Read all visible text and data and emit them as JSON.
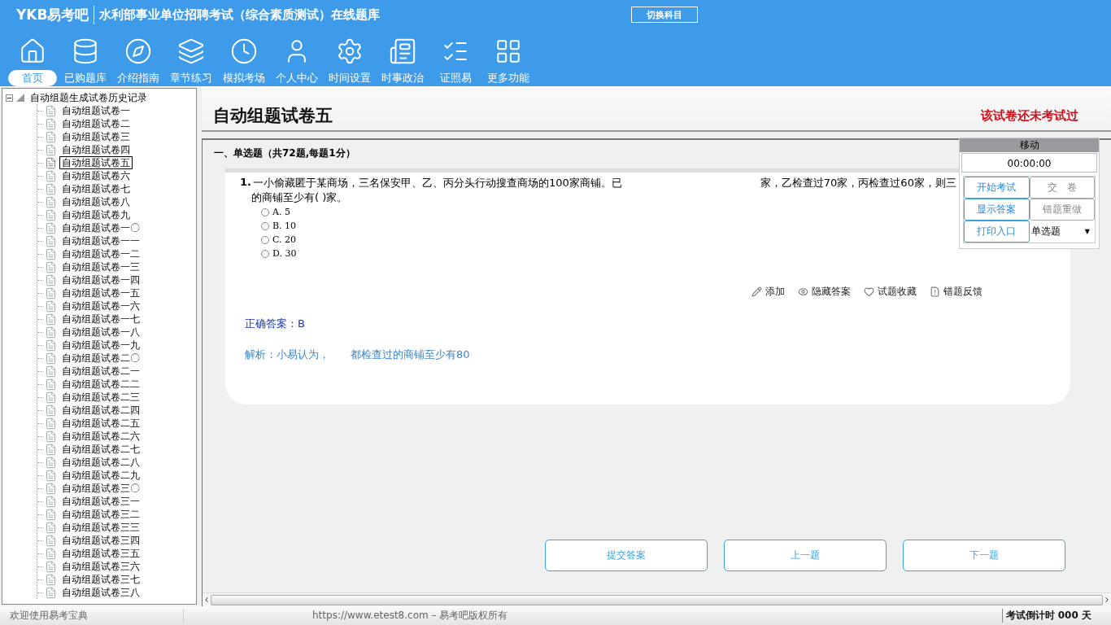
{
  "header": {
    "logo": "YKB易考吧",
    "title": "水利部事业单位招聘考试（综合素质测试）在线题库",
    "switch_button": "切换科目"
  },
  "toolbar": [
    {
      "label": "首页",
      "selected": true
    },
    {
      "label": "已购题库",
      "selected": false
    },
    {
      "label": "介绍指南",
      "selected": false
    },
    {
      "label": "章节练习",
      "selected": false
    },
    {
      "label": "模拟考场",
      "selected": false
    },
    {
      "label": "个人中心",
      "selected": false
    },
    {
      "label": "时间设置",
      "selected": false
    },
    {
      "label": "时事政治",
      "selected": false
    },
    {
      "label": "证照易",
      "selected": false
    },
    {
      "label": "更多功能",
      "selected": false
    }
  ],
  "tree": {
    "root": "自动组题生成试卷历史记录",
    "expanded": true,
    "children": [
      {
        "label": "自动组题试卷一",
        "selected": false
      },
      {
        "label": "自动组题试卷二",
        "selected": false
      },
      {
        "label": "自动组题试卷三",
        "selected": false
      },
      {
        "label": "自动组题试卷四",
        "selected": false
      },
      {
        "label": "自动组题试卷五",
        "selected": true
      },
      {
        "label": "自动组题试卷六",
        "selected": false
      },
      {
        "label": "自动组题试卷七",
        "selected": false
      },
      {
        "label": "自动组题试卷八",
        "selected": false
      },
      {
        "label": "自动组题试卷九",
        "selected": false
      },
      {
        "label": "自动组题试卷一〇",
        "selected": false
      },
      {
        "label": "自动组题试卷一一",
        "selected": false
      },
      {
        "label": "自动组题试卷一二",
        "selected": false
      },
      {
        "label": "自动组题试卷一三",
        "selected": false
      },
      {
        "label": "自动组题试卷一四",
        "selected": false
      },
      {
        "label": "自动组题试卷一五",
        "selected": false
      },
      {
        "label": "自动组题试卷一六",
        "selected": false
      },
      {
        "label": "自动组题试卷一七",
        "selected": false
      },
      {
        "label": "自动组题试卷一八",
        "selected": false
      },
      {
        "label": "自动组题试卷一九",
        "selected": false
      },
      {
        "label": "自动组题试卷二〇",
        "selected": false
      },
      {
        "label": "自动组题试卷二一",
        "selected": false
      },
      {
        "label": "自动组题试卷二二",
        "selected": false
      },
      {
        "label": "自动组题试卷二三",
        "selected": false
      },
      {
        "label": "自动组题试卷二四",
        "selected": false
      },
      {
        "label": "自动组题试卷二五",
        "selected": false
      },
      {
        "label": "自动组题试卷二六",
        "selected": false
      },
      {
        "label": "自动组题试卷二七",
        "selected": false
      },
      {
        "label": "自动组题试卷二八",
        "selected": false
      },
      {
        "label": "自动组题试卷二九",
        "selected": false
      },
      {
        "label": "自动组题试卷三〇",
        "selected": false
      },
      {
        "label": "自动组题试卷三一",
        "selected": false
      },
      {
        "label": "自动组题试卷三二",
        "selected": false
      },
      {
        "label": "自动组题试卷三三",
        "selected": false
      },
      {
        "label": "自动组题试卷三四",
        "selected": false
      },
      {
        "label": "自动组题试卷三五",
        "selected": false
      },
      {
        "label": "自动组题试卷三六",
        "selected": false
      },
      {
        "label": "自动组题试卷三七",
        "selected": false
      },
      {
        "label": "自动组题试卷三八",
        "selected": false
      }
    ]
  },
  "paper": {
    "title": "自动组题试卷五",
    "status": "该试卷还未考试过",
    "section": "一、单选题（共72题,每题1分）"
  },
  "question": {
    "number": "1.",
    "text_before": "一小偷藏匿于某商场，三名保安甲、乙、丙分头行动搜查商场的100家商铺。已",
    "text_after": "家，乙检查过70家，丙检查过60家，则三",
    "text_line2": "的商铺至少有( )家。",
    "options": [
      {
        "label": "A. 5",
        "selected": false
      },
      {
        "label": "B. 10",
        "selected": false
      },
      {
        "label": "C. 20",
        "selected": false
      },
      {
        "label": "D. 30",
        "selected": false
      }
    ],
    "tools": [
      "添加",
      "隐藏答案",
      "试题收藏",
      "错题反馈"
    ],
    "answer": "正确答案：B",
    "analysis_before": "解析：小易认为，",
    "analysis_after": "都检查过的商铺至少有80"
  },
  "float_panel": {
    "title": "移动",
    "timer": "00:00:00",
    "buttons": [
      {
        "label": "开始考试",
        "disabled": false
      },
      {
        "label": "交　卷",
        "disabled": true
      },
      {
        "label": "显示答案",
        "disabled": false
      },
      {
        "label": "错题重做",
        "disabled": true
      },
      {
        "label": "打印入口",
        "disabled": false
      }
    ],
    "select": {
      "value": "单选题",
      "arrow": "▼"
    }
  },
  "nav_buttons": [
    "提交答案",
    "上一题",
    "下一题"
  ],
  "status_bar": {
    "welcome": "欢迎使用易考宝典",
    "copyright": "https://www.etest8.com – 易考吧版权所有",
    "countdown": "考试倒计时 000 天"
  }
}
